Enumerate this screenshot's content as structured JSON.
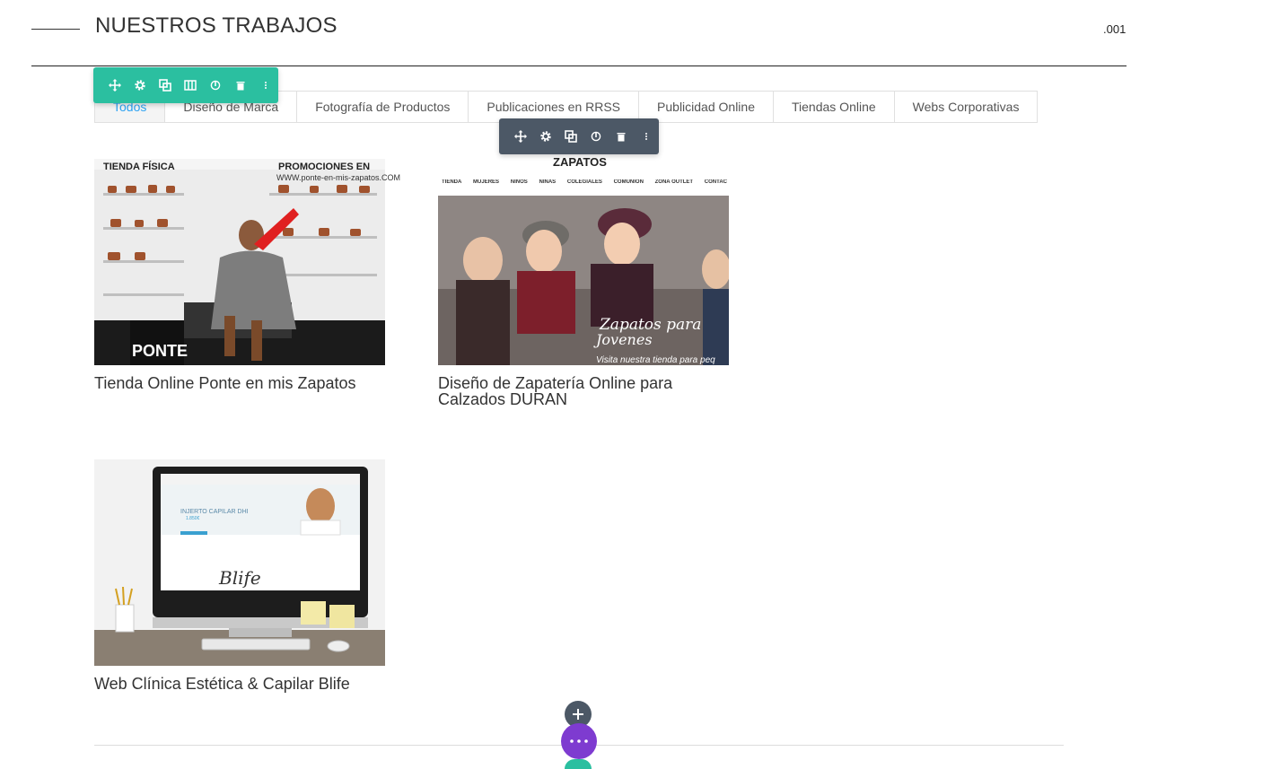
{
  "section": {
    "title": "NUESTROS TRABAJOS",
    "number": ".001"
  },
  "filters": [
    {
      "label": "Todos",
      "active": true
    },
    {
      "label": "Diseño de Marca"
    },
    {
      "label": "Fotografía de Productos"
    },
    {
      "label": "Publicaciones en RRSS"
    },
    {
      "label": "Publicidad Online"
    },
    {
      "label": "Tiendas Online"
    },
    {
      "label": "Webs Corporativas"
    }
  ],
  "projects": [
    {
      "title": "Tienda Online Ponte en mis Zapatos",
      "image_text": {
        "top_left": "TIENDA FÍSICA",
        "top_right": "PROMOCIONES EN",
        "url": "WWW.ponte-en-mis-zapatos.COM",
        "logo": "PONTE"
      }
    },
    {
      "title": "Diseño de Zapatería Online para Calzados DURAN",
      "image_text": {
        "brand": "ZAPATOS",
        "nav": [
          "TIENDA",
          "MUJERES",
          "NIÑOS",
          "NIÑAS",
          "COLEGIALES",
          "COMUNIÓN",
          "ZONA OUTLET",
          "CONTAC"
        ],
        "slogan_1": "Zapatos para",
        "slogan_2": "Jovenes",
        "tagline": "Visita nuestra tienda para peq"
      }
    },
    {
      "title": "Web Clínica Estética & Capilar Blife",
      "image_text": {
        "headline": "INJERTO CAPILAR DHI",
        "price": "1.850€",
        "logo": "Blife"
      }
    }
  ],
  "toolbars": {
    "module": [
      "move-icon",
      "gear-icon",
      "duplicate-icon",
      "columns-icon",
      "power-icon",
      "trash-icon",
      "more-icon"
    ],
    "row": [
      "move-icon",
      "gear-icon",
      "duplicate-icon",
      "power-icon",
      "trash-icon",
      "more-icon"
    ]
  },
  "colors": {
    "accent_green": "#2bbfa0",
    "toolbar_dark": "#4c5866",
    "purple": "#7e3bd0",
    "active_filter": "#2ea3f2"
  }
}
